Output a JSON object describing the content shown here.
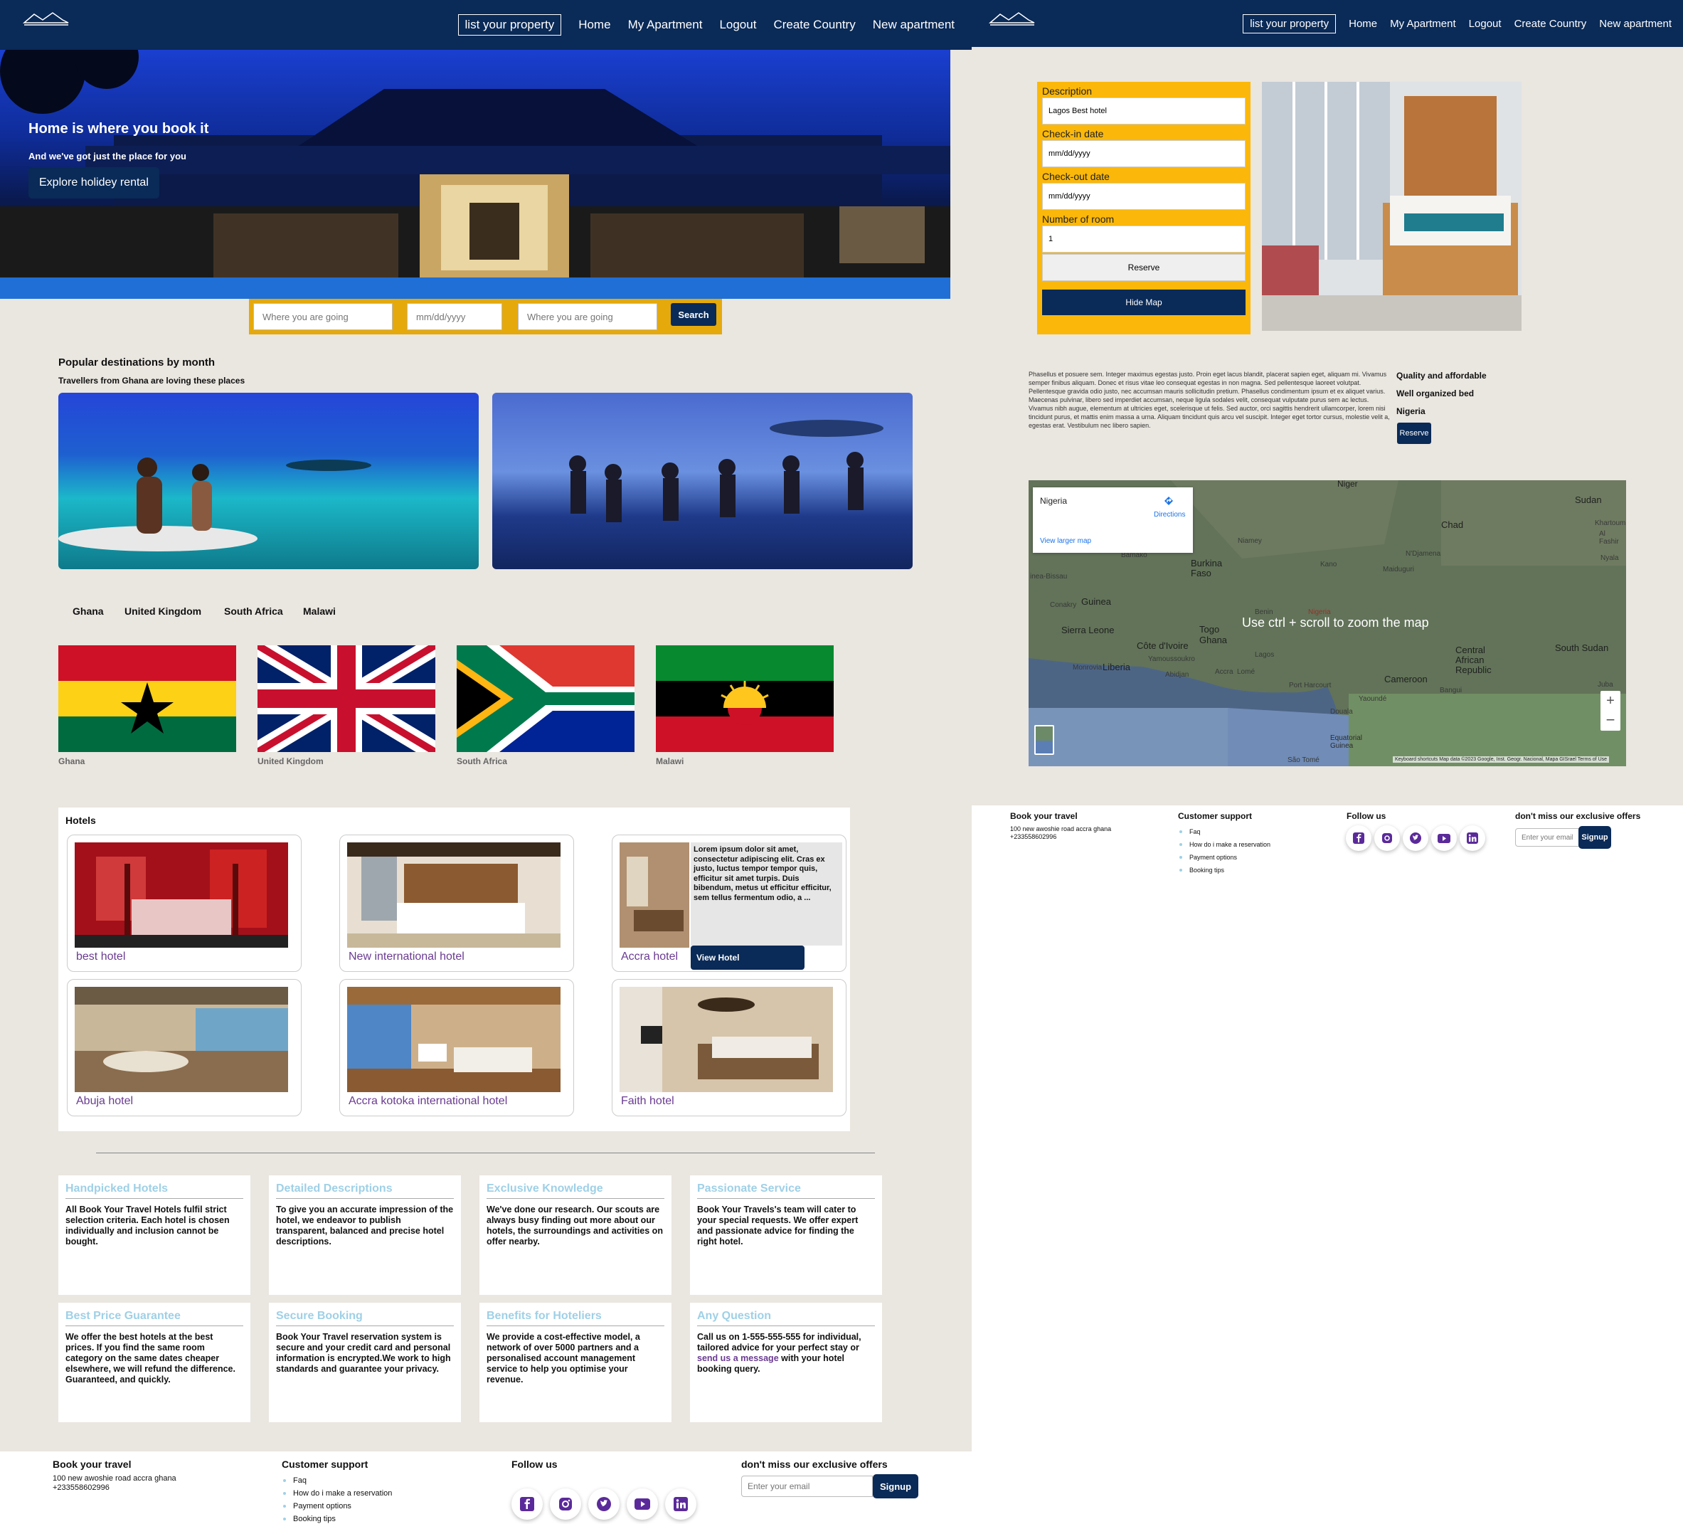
{
  "nav": {
    "list_property": "list your property",
    "home": "Home",
    "my_apartment": "My Apartment",
    "logout": "Logout",
    "create_country": "Create Country",
    "new_apartment": "New apartment"
  },
  "hero": {
    "title": "Home is where you book it",
    "subtitle": "And we've got just the place for you",
    "button": "Explore holidey rental"
  },
  "search": {
    "where_placeholder": "Where you are going",
    "date_placeholder": "mm/dd/yyyy",
    "where2_placeholder": "Where you are going",
    "button": "Search"
  },
  "popular": {
    "title": "Popular destinations by month",
    "subtitle": "Travellers from Ghana are loving these places"
  },
  "country_tabs": [
    "Ghana",
    "United Kingdom",
    "South Africa",
    "Malawi"
  ],
  "flags": [
    {
      "caption": "Ghana"
    },
    {
      "caption": "United Kingdom"
    },
    {
      "caption": "South Africa"
    },
    {
      "caption": "Malawi"
    }
  ],
  "hotels": {
    "title": "Hotels",
    "items": [
      "best hotel",
      "New international hotel",
      "Accra hotel",
      "Abuja hotel",
      "Accra kotoka international hotel",
      "Faith hotel"
    ],
    "hover_text": "Lorem ipsum dolor sit amet, consectetur adipiscing elit. Cras ex justo, luctus tempor tempor quis, efficitur sit amet turpis. Duis bibendum, metus ut efficitur efficitur, sem tellus fermentum odio, a ...",
    "view_button": "View Hotel"
  },
  "features": [
    {
      "title": "Handpicked Hotels",
      "text": "All Book Your Travel Hotels fulfil strict selection criteria. Each hotel is chosen individually and inclusion cannot be bought."
    },
    {
      "title": "Detailed Descriptions",
      "text": "To give you an accurate impression of the hotel, we endeavor to publish transparent, balanced and precise hotel descriptions."
    },
    {
      "title": "Exclusive Knowledge",
      "text": "We've done our research. Our scouts are always busy finding out more about our hotels, the surroundings and activities on offer nearby."
    },
    {
      "title": "Passionate Service",
      "text": "Book Your Travels's team will cater to your special requests. We offer expert and passionate advice for finding the right hotel."
    },
    {
      "title": "Best Price Guarantee",
      "text": "We offer the best hotels at the best prices. If you find the same room category on the same dates cheaper elsewhere, we will refund the difference. Guaranteed, and quickly."
    },
    {
      "title": "Secure Booking",
      "text": "Book Your Travel reservation system is secure and your credit card and personal information is encrypted.We work to high standards and guarantee your privacy."
    },
    {
      "title": "Benefits for Hoteliers",
      "text": "We provide a cost-effective model, a network of over 5000 partners and a personalised account management service to help you optimise your revenue."
    },
    {
      "title": "Any Question",
      "text_before": "Call us on 1-555-555-555 for individual, tailored advice for your perfect stay or",
      "link": "send us a message",
      "text_after": "with your hotel booking query."
    }
  ],
  "footer": {
    "book_title": "Book your travel",
    "address": "100 new awoshie road accra ghana",
    "phone": "+233558602996",
    "support_title": "Customer support",
    "support_links": [
      "Faq",
      "How do i make a reservation",
      "Payment options",
      "Booking tips"
    ],
    "follow_title": "Follow us",
    "offers_title": "don't miss our exclusive offers",
    "email_placeholder": "Enter your email",
    "signup": "Signup"
  },
  "booking": {
    "description_label": "Description",
    "description_value": "Lagos Best hotel",
    "checkin_label": "Check-in date",
    "checkout_label": "Check-out date",
    "date_value": "mm/dd/yyyy",
    "rooms_label": "Number of room",
    "rooms_value": "1",
    "reserve": "Reserve",
    "hide_map": "Hide Map"
  },
  "details": {
    "paragraph": "Phasellus et posuere sem. Integer maximus egestas justo. Proin eget lacus blandit, placerat sapien eget, aliquam mi. Vivamus semper finibus aliquam. Donec et risus vitae leo consequat egestas in non magna. Sed pellentesque laoreet volutpat. Pellentesque gravida odio justo, nec accumsan mauris sollicitudin pretium. Phasellus condimentum ipsum et ex aliquet varius. Maecenas pulvinar, libero sed imperdiet accumsan, neque ligula sodales velit, consequat vulputate purus sem ac lectus. Vivamus nibh augue, elementum at ultricies eget, scelerisque ut felis. Sed auctor, orci sagittis hendrerit ullamcorper, lorem nisi tincidunt purus, et mattis enim massa a urna. Aliquam tincidunt quis arcu vel suscipit. Integer eget tortor cursus, molestie velit a, egestas erat. Vestibulum nec libero sapien.",
    "feature1": "Quality and affordable",
    "feature2": "Well organized bed",
    "country": "Nigeria",
    "reserve": "Reserve"
  },
  "map": {
    "place": "Nigeria",
    "directions": "Directions",
    "larger": "View larger map",
    "hint": "Use ctrl + scroll to zoom the map",
    "labels": [
      "Niger",
      "Sudan",
      "Chad",
      "Khartoum",
      "Niamey",
      "N'Djamena",
      "Burkina Faso",
      "Kano",
      "Maiduguri",
      "Guinea",
      "Benin",
      "Nigeria",
      "Sierra Leone",
      "Togo",
      "Côte d'Ivoire",
      "Ghana",
      "Lagos",
      "South Sudan",
      "Central African Republic",
      "Liberia",
      "Abidjan",
      "Accra",
      "Lomé",
      "Cameroon",
      "Port Harcourt",
      "Bangui",
      "Juba",
      "Douala",
      "Yaoundé",
      "Equatorial Guinea",
      "Bamako",
      "Conakry",
      "Monrovia",
      "Yamoussoukro",
      "São Tomé",
      "inea-Bissau",
      "Al Fashir",
      "Nyala"
    ],
    "attribution": "Keyboard shortcuts   Map data ©2023 Google, Inst. Geogr. Nacional, Mapa GISrael   Terms of Use"
  },
  "colors": {
    "navy": "#0a2a57",
    "gold": "#e5a90c",
    "form_yellow": "#fbb80a",
    "feature_title": "#9fd0e6",
    "hotel_name": "#6a3b91",
    "page_bg": "#eae6e0"
  }
}
